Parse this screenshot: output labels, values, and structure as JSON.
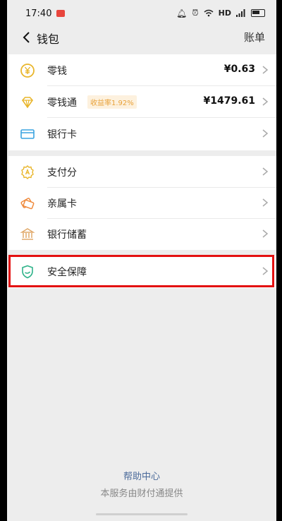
{
  "status_bar": {
    "time": "17:40",
    "hd": "HD"
  },
  "header": {
    "title": "钱包",
    "bill_label": "账单"
  },
  "wallet_items": [
    {
      "label": "零钱",
      "value": "¥0.63",
      "icon": "yen-coin-icon",
      "color": "#e9b62c"
    },
    {
      "label": "零钱通",
      "badge": "收益率1.92%",
      "value": "¥1479.61",
      "icon": "diamond-icon",
      "color": "#e9b62c"
    },
    {
      "label": "银行卡",
      "icon": "bank-card-icon",
      "color": "#3aa3e0"
    }
  ],
  "finance_items": [
    {
      "label": "支付分",
      "icon": "pay-score-icon",
      "color": "#e9b62c"
    },
    {
      "label": "亲属卡",
      "icon": "family-card-icon",
      "color": "#ef8a3c"
    },
    {
      "label": "银行储蓄",
      "icon": "savings-icon",
      "color": "#e0a86a"
    }
  ],
  "security_item": {
    "label": "安全保障",
    "icon": "shield-icon",
    "color": "#2fb38a"
  },
  "footer": {
    "help": "帮助中心",
    "service": "本服务由财付通提供"
  },
  "colors": {
    "highlight": "#e31010",
    "background": "#ededed"
  }
}
